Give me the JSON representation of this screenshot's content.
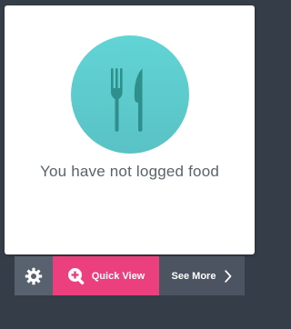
{
  "card": {
    "icon": "fork-knife-icon",
    "message": "You have not logged food"
  },
  "toolbar": {
    "settings_icon": "gear-icon",
    "quick_view_label": "Quick View",
    "quick_view_icon": "zoom-plus-icon",
    "see_more_label": "See More",
    "see_more_icon": "chevron-right-icon"
  },
  "colors": {
    "background": "#353e48",
    "card": "#ffffff",
    "accent_teal": "#5ecfd1",
    "accent_pink": "#ec3f7e",
    "toolbar_dark": "#4b5460"
  }
}
